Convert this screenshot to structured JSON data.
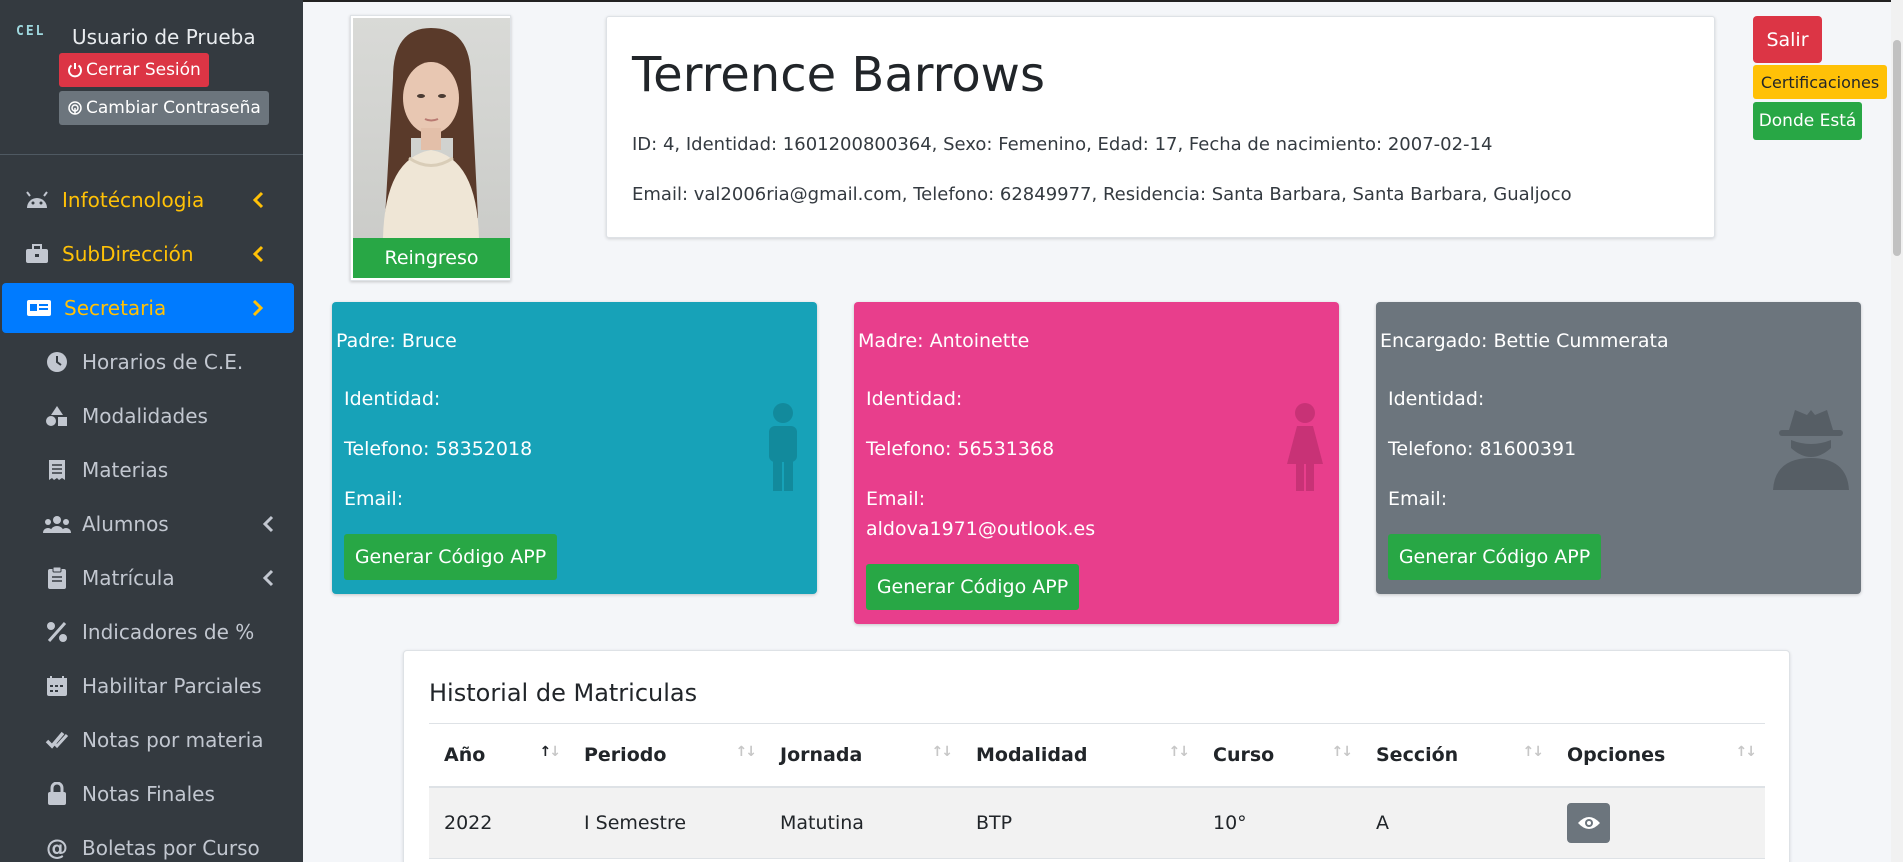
{
  "sidebar": {
    "logo": "CEL",
    "user_name": "Usuario de Prueba",
    "logout_label": "Cerrar Sesión",
    "change_password_label": "Cambiar Contraseña",
    "nav": {
      "infotecnologia": "Infotécnologia",
      "subdireccion": "SubDirección",
      "secretaria": "Secretaria",
      "horarios": "Horarios de C.E.",
      "modalidades": "Modalidades",
      "materias": "Materias",
      "alumnos": "Alumnos",
      "matricula": "Matrícula",
      "indicadores": "Indicadores de %",
      "habilitar": "Habilitar Parciales",
      "notas_materia": "Notas por materia",
      "notas_finales": "Notas Finales",
      "boletas": "Boletas por Curso"
    }
  },
  "student": {
    "name": "Terrence Barrows",
    "status_label": "Reingreso",
    "line1": "ID: 4, Identidad: 1601200800364, Sexo: Femenino, Edad: 17, Fecha de nacimiento: 2007-02-14",
    "line2": "Email: val2006ria@gmail.com, Telefono: 62849977, Residencia: Santa Barbara, Santa Barbara, Gualjoco"
  },
  "actions": {
    "salir": "Salir",
    "certificaciones": "Certificaciones",
    "donde_esta": "Donde Está"
  },
  "guardians": {
    "padre": {
      "title": "Padre: Bruce",
      "identidad": "Identidad:",
      "telefono": "Telefono: 58352018",
      "email_label": "Email:",
      "email": "",
      "button": "Generar Código APP",
      "color": "#17a2b8"
    },
    "madre": {
      "title": "Madre: Antoinette",
      "identidad": "Identidad:",
      "telefono": "Telefono: 56531368",
      "email_label": "Email:",
      "email": "aldova1971@outlook.es",
      "button": "Generar Código APP",
      "color": "#e83e8c"
    },
    "encargado": {
      "title": "Encargado: Bettie Cummerata",
      "identidad": "Identidad:",
      "telefono": "Telefono: 81600391",
      "email_label": "Email:",
      "email": "",
      "button": "Generar Código APP",
      "color": "#6c757d"
    }
  },
  "history": {
    "title": "Historial de Matriculas",
    "columns": [
      "Año",
      "Periodo",
      "Jornada",
      "Modalidad",
      "Curso",
      "Sección",
      "Opciones"
    ],
    "rows": [
      [
        "2022",
        "I Semestre",
        "Matutina",
        "BTP",
        "10°",
        "A"
      ]
    ]
  }
}
